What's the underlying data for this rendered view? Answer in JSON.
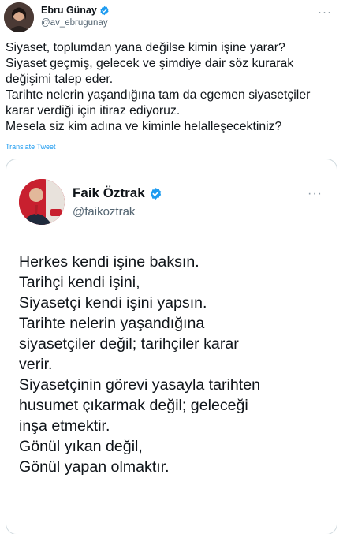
{
  "tweet": {
    "author": {
      "name": "Ebru Günay",
      "handle": "@av_ebrugunay"
    },
    "more_label": "···",
    "lines": [
      "Siyaset, toplumdan yana değilse kimin işine yarar?",
      "Siyaset geçmiş, gelecek ve şimdiye dair söz kurarak",
      "değişimi talep eder.",
      "Tarihte nelerin yaşandığına tam da egemen siyasetçiler",
      "karar verdiği için itiraz ediyoruz.",
      "Mesela siz kim adına ve kiminle helalleşecektiniz?"
    ],
    "translate_label": "Translate Tweet"
  },
  "quote": {
    "author": {
      "name": "Faik Öztrak",
      "handle": "@faikoztrak"
    },
    "more_label": "···",
    "lines": [
      "Herkes kendi işine baksın.",
      "Tarihçi kendi işini,",
      "Siyasetçi kendi işini yapsın.",
      "Tarihte nelerin yaşandığına",
      "siyasetçiler değil; tarihçiler karar",
      "verir.",
      "Siyasetçinin görevi yasayla tarihten",
      "husumet çıkarmak değil; geleceği",
      "inşa etmektir.",
      "Gönül yıkan değil,",
      "Gönül yapan olmaktır."
    ]
  },
  "icons": {
    "verified": "verified-badge-icon",
    "more": "more-options-icon"
  },
  "colors": {
    "verified": "#1d9bf0",
    "link": "#1d9bf0",
    "secondary_text": "#536471",
    "border": "#cfd9de"
  }
}
